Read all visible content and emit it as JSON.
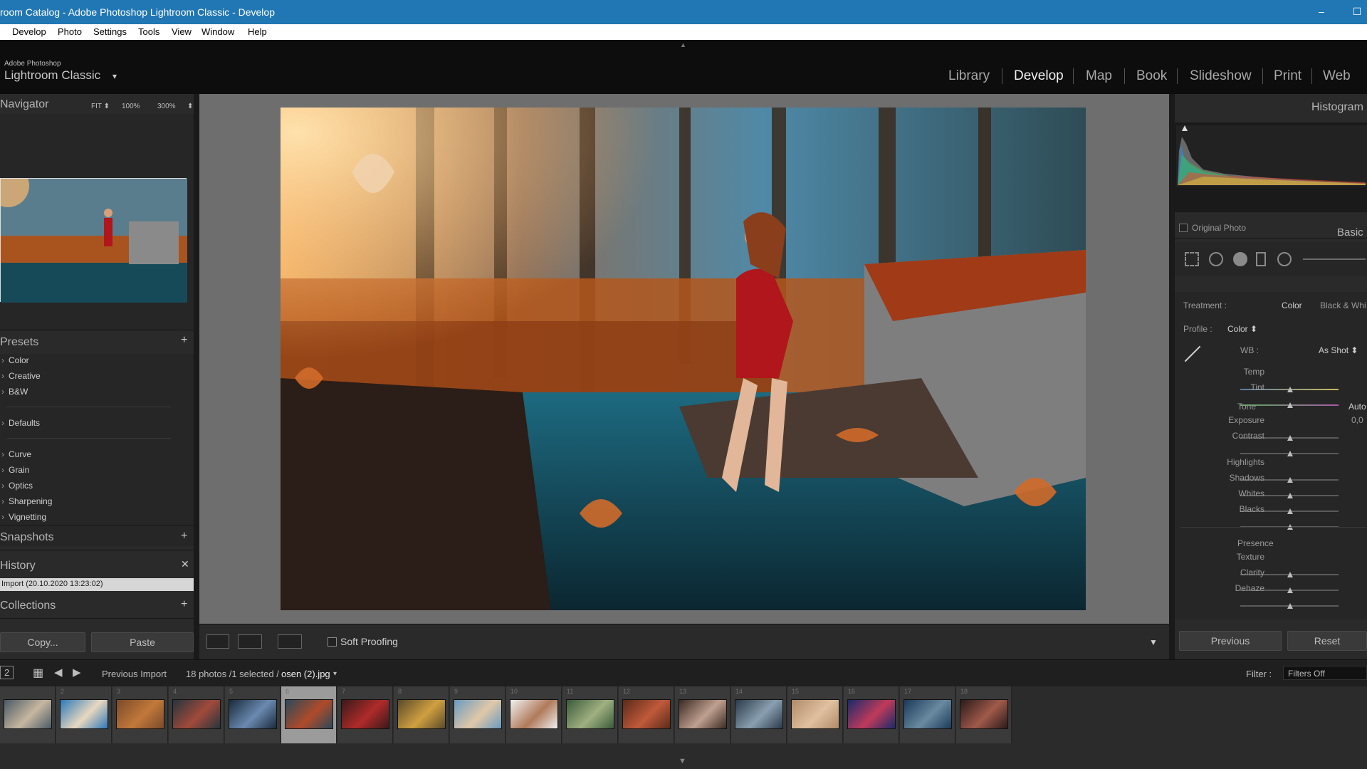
{
  "window": {
    "title": "room Catalog - Adobe Photoshop Lightroom Classic - Develop",
    "minimize": "–",
    "maximize": "☐"
  },
  "menu": [
    "Develop",
    "Photo",
    "Settings",
    "Tools",
    "View",
    "Window",
    "Help"
  ],
  "identity": {
    "small": "Adobe Photoshop",
    "big": "Lightroom Classic",
    "caret": "▾"
  },
  "modules": [
    "Library",
    "Develop",
    "Map",
    "Book",
    "Slideshow",
    "Print",
    "Web"
  ],
  "active_module": "Develop",
  "left": {
    "navigator": {
      "title": "Navigator",
      "zoom": [
        "FIT ⬍",
        "100%",
        "300%"
      ],
      "stepper": "⬍"
    },
    "presets": {
      "title": "Presets",
      "add": "+",
      "items": [
        "Color",
        "Creative",
        "B&W",
        "Defaults",
        "Curve",
        "Grain",
        "Optics",
        "Sharpening",
        "Vignetting"
      ]
    },
    "snapshots": {
      "title": "Snapshots",
      "add": "+"
    },
    "history": {
      "title": "History",
      "close": "✕",
      "entry": "Import (20.10.2020 13:23:02)"
    },
    "collections": {
      "title": "Collections",
      "add": "+"
    },
    "copy_btn": "Copy...",
    "paste_btn": "Paste"
  },
  "toolbar": {
    "soft_proofing": "Soft Proofing",
    "expand": "▼"
  },
  "right": {
    "histogram": {
      "title": "Histogram",
      "original_photo": "Original Photo"
    },
    "basic": {
      "title": "Basic",
      "treatment_label": "Treatment :",
      "treatment_color": "Color",
      "treatment_bw": "Black & Whi",
      "profile_label": "Profile :",
      "profile_value": "Color ⬍",
      "wb_label": "WB :",
      "wb_value": "As Shot ⬍",
      "temp": "Temp",
      "tint": "Tint",
      "tone": "Tone",
      "auto": "Auto",
      "exposure": "Exposure",
      "exposure_value": "0,0",
      "contrast": "Contrast",
      "highlights": "Highlights",
      "shadows": "Shadows",
      "whites": "Whites",
      "blacks": "Blacks",
      "presence": "Presence",
      "texture": "Texture",
      "clarity": "Clarity",
      "dehaze": "Dehaze"
    },
    "previous_btn": "Previous",
    "reset_btn": "Reset"
  },
  "filmstrip_bar": {
    "page": "2",
    "source": "Previous Import",
    "count": "18 photos /1 selected /",
    "filename": "osen (2).jpg",
    "filter_label": "Filter :",
    "filter_value": "Filters Off"
  },
  "filmstrip": {
    "numbers": [
      "",
      "2",
      "3",
      "4",
      "5",
      "6",
      "7",
      "8",
      "9",
      "10",
      "11",
      "12",
      "13",
      "14",
      "15",
      "16",
      "17",
      "18"
    ],
    "selected_index": 5
  }
}
